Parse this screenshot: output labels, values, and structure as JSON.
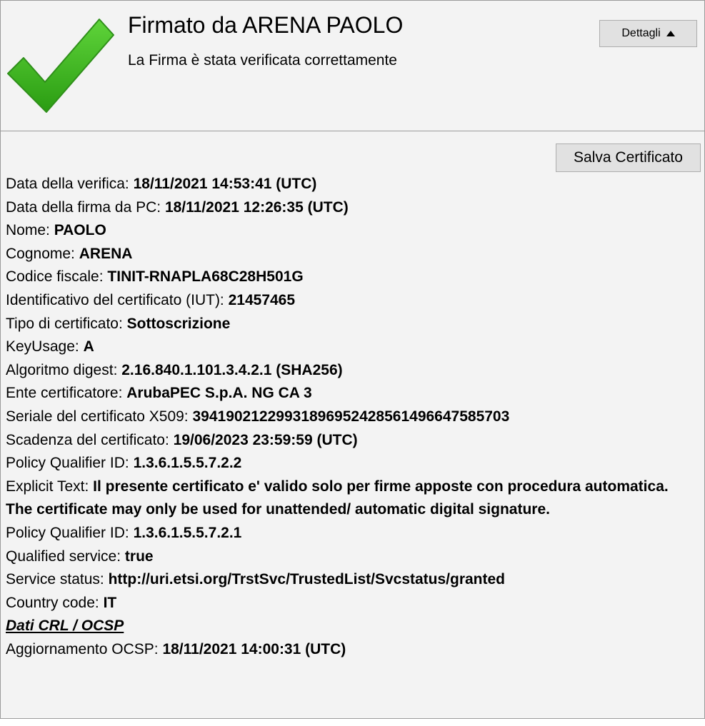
{
  "header": {
    "title": "Firmato da ARENA PAOLO",
    "status": "La Firma è stata verificata correttamente",
    "details_label": "Dettagli",
    "check_color": "#39b51c"
  },
  "toolbar": {
    "save_label": "Salva Certificato"
  },
  "fields": [
    {
      "label": "Data della verifica: ",
      "value": "18/11/2021 14:53:41 (UTC)"
    },
    {
      "label": "Data della firma da PC: ",
      "value": "18/11/2021 12:26:35 (UTC)"
    },
    {
      "label": "Nome: ",
      "value": "PAOLO"
    },
    {
      "label": "Cognome: ",
      "value": "ARENA"
    },
    {
      "label": "Codice fiscale: ",
      "value": "TINIT-RNAPLA68C28H501G"
    },
    {
      "label": "Identificativo del certificato (IUT): ",
      "value": "21457465"
    },
    {
      "label": "Tipo di certificato: ",
      "value": "Sottoscrizione"
    },
    {
      "label": "KeyUsage: ",
      "value": "A"
    },
    {
      "label": "Algoritmo digest: ",
      "value": "2.16.840.1.101.3.4.2.1 (SHA256)"
    },
    {
      "label": "Ente certificatore: ",
      "value": "ArubaPEC S.p.A. NG CA 3"
    },
    {
      "label": "Seriale del certificato X509: ",
      "value": "39419021229931896952428561496647585703"
    },
    {
      "label": "Scadenza del certificato: ",
      "value": "19/06/2023 23:59:59 (UTC)"
    },
    {
      "label": "Policy Qualifier ID: ",
      "value": "1.3.6.1.5.5.7.2.2"
    },
    {
      "label": "Explicit Text: ",
      "value": "Il presente certificato e' valido solo per firme apposte con procedura automatica. The certificate may only be used for unattended/ automatic digital signature."
    },
    {
      "label": "Policy Qualifier ID: ",
      "value": "1.3.6.1.5.5.7.2.1"
    },
    {
      "label": "Qualified service: ",
      "value": "true"
    },
    {
      "label": "Service status: ",
      "value": "http://uri.etsi.org/TrstSvc/TrustedList/Svcstatus/granted"
    },
    {
      "label": "Country code: ",
      "value": "IT"
    }
  ],
  "crl_link": "Dati CRL / OCSP",
  "ocsp": {
    "label": "Aggiornamento OCSP: ",
    "value": "18/11/2021 14:00:31 (UTC)"
  }
}
